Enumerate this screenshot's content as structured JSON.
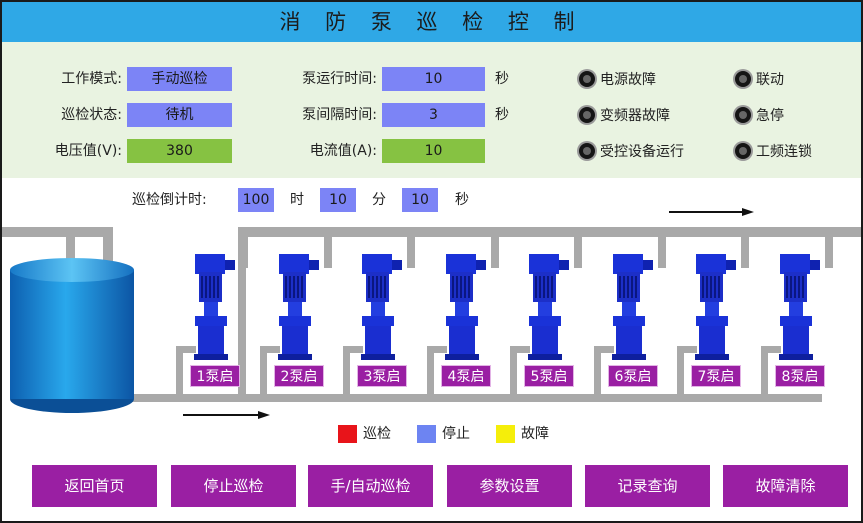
{
  "title": "消 防 泵 巡 检 控 制",
  "status": {
    "work_mode_label": "工作模式:",
    "work_mode": "手动巡检",
    "patrol_state_label": "巡检状态:",
    "patrol_state": "待机",
    "voltage_label": "电压值(V):",
    "voltage": "380",
    "run_time_label": "泵运行时间:",
    "run_time": "10",
    "run_time_unit": "秒",
    "interval_label": "泵间隔时间:",
    "interval": "3",
    "interval_unit": "秒",
    "current_label": "电流值(A):",
    "current": "10"
  },
  "indicators": {
    "power_fault": "电源故障",
    "linkage": "联动",
    "vfd_fault": "变频器故障",
    "estop": "急停",
    "controlled_running": "受控设备运行",
    "pf_interlock": "工频连锁"
  },
  "countdown": {
    "label": "巡检倒计时:",
    "hours": "100",
    "hours_unit": "时",
    "minutes": "10",
    "minutes_unit": "分",
    "seconds": "10",
    "seconds_unit": "秒"
  },
  "pumps": [
    "1泵启",
    "2泵启",
    "3泵启",
    "4泵启",
    "5泵启",
    "6泵启",
    "7泵启",
    "8泵启"
  ],
  "legend": {
    "patrol": "巡检",
    "stop": "停止",
    "fault": "故障",
    "patrol_color": "#e8141a",
    "stop_color": "#6d84f2",
    "fault_color": "#f5ee0a"
  },
  "buttons": {
    "home": "返回首页",
    "stop_patrol": "停止巡检",
    "manual_auto": "手/自动巡检",
    "params": "参数设置",
    "records": "记录查询",
    "clear_fault": "故障清除"
  }
}
